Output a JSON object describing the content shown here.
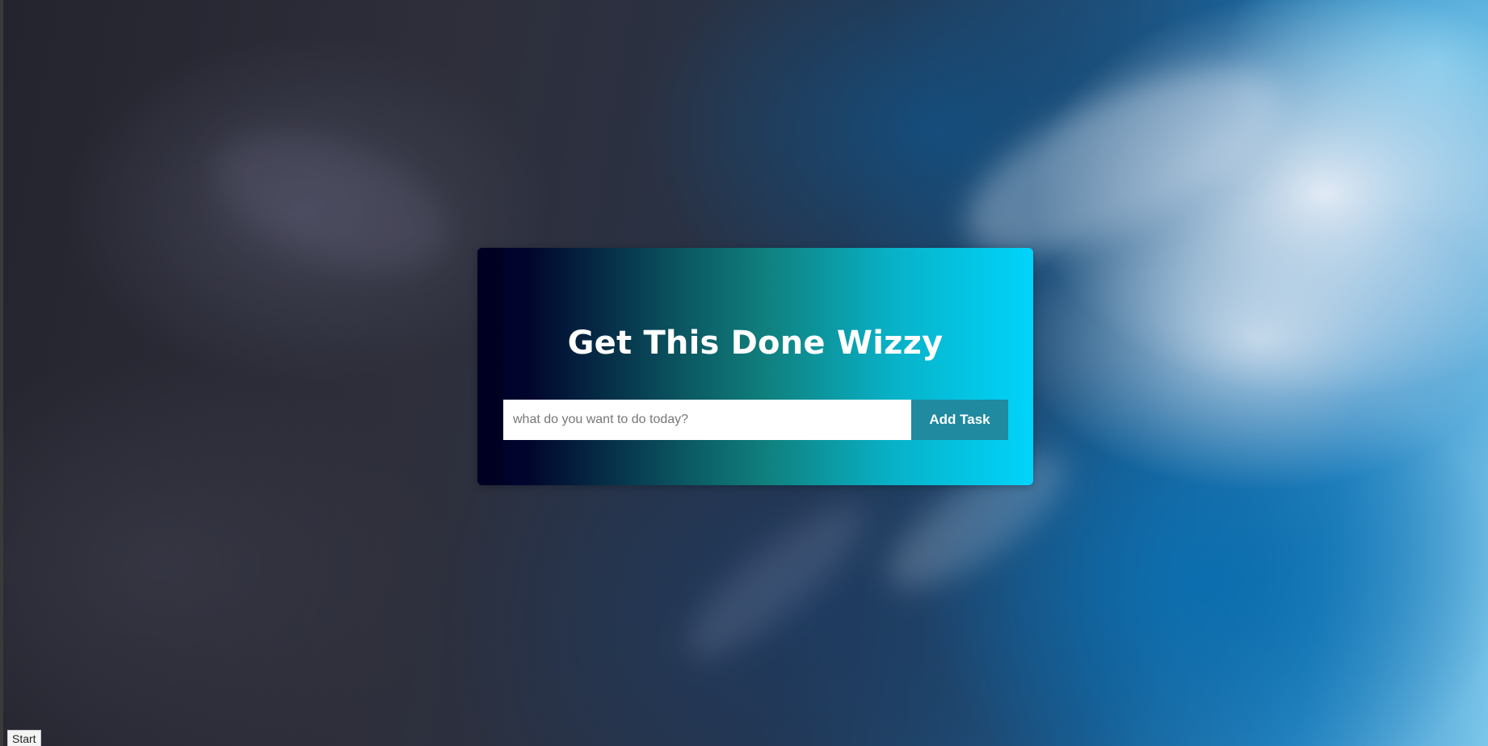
{
  "app": {
    "title": "Get This Done Wizzy"
  },
  "task_form": {
    "input_value": "",
    "input_placeholder": "what do you want to do today?",
    "add_button_label": "Add Task"
  },
  "taskbar": {
    "start_label": "Start"
  },
  "colors": {
    "card_gradient_start": "#00002a",
    "card_gradient_mid": "#10807e",
    "card_gradient_end": "#00d4fb",
    "add_button": "#1f8aa0",
    "title_text": "#ffffff"
  }
}
